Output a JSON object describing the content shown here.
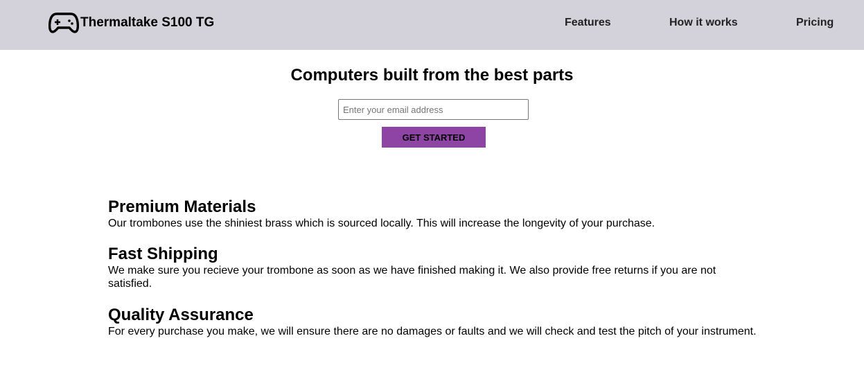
{
  "header": {
    "brand": "Thermaltake S100 TG",
    "logo_icon": "gamepad-icon",
    "nav": [
      {
        "label": "Features"
      },
      {
        "label": "How it works"
      },
      {
        "label": "Pricing"
      }
    ],
    "background": "#d3d2da"
  },
  "hero": {
    "title": "Computers built from the best parts",
    "email_placeholder": "Enter your email address",
    "email_value": "",
    "cta_label": "GET STARTED",
    "cta_color": "#8e44a4"
  },
  "features": [
    {
      "title": "Premium Materials",
      "text": "Our trombones use the shiniest brass which is sourced locally. This will increase the longevity of your purchase."
    },
    {
      "title": "Fast Shipping",
      "text": "We make sure you recieve your trombone as soon as we have finished making it. We also provide free returns if you are not satisfied."
    },
    {
      "title": "Quality Assurance",
      "text": "For every purchase you make, we will ensure there are no damages or faults and we will check and test the pitch of your instrument."
    }
  ]
}
